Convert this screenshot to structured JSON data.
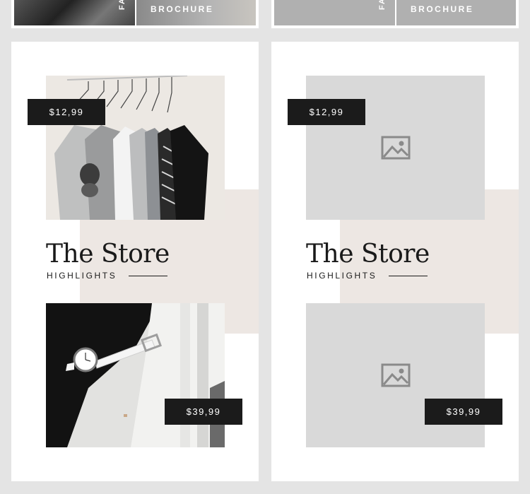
{
  "top_strip": {
    "left_vertical_text": "FA",
    "left_brochure": "BROCHURE",
    "right_vertical_text": "FA",
    "right_brochure": "BROCHURE"
  },
  "cards": [
    {
      "price_top": "$12,99",
      "title": "The Store",
      "subtitle": "HIGHLIGHTS",
      "price_bottom": "$39,99"
    },
    {
      "price_top": "$12,99",
      "title": "The Store",
      "subtitle": "HIGHLIGHTS",
      "price_bottom": "$39,99"
    }
  ],
  "colors": {
    "background": "#e4e4e4",
    "card": "#ffffff",
    "accent_beige": "#ede7e3",
    "price_tag": "#1b1b1b",
    "placeholder": "#d9d9d9"
  },
  "icons": [
    "image-placeholder-icon"
  ]
}
